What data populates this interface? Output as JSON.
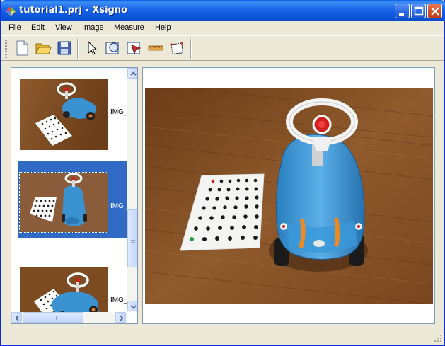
{
  "window": {
    "title": "tutorial1.prj - Xsigno",
    "title_bar_color": "#0a54dc"
  },
  "menu": {
    "items": [
      "File",
      "Edit",
      "View",
      "Image",
      "Measure",
      "Help"
    ]
  },
  "toolbar": {
    "icons": [
      "new-document-icon",
      "open-folder-icon",
      "save-disk-icon",
      "select-arrow-icon",
      "circle-marker-icon",
      "region-marker-icon",
      "ruler-icon",
      "polygon-icon"
    ]
  },
  "thumbnails": {
    "items": [
      {
        "label": "IMG_",
        "selected": false
      },
      {
        "label": "IMG_",
        "selected": true
      },
      {
        "label": "IMG_",
        "selected": false
      }
    ],
    "selection_color": "#316ac5"
  },
  "colors": {
    "floor": "#8a5424",
    "car_blue": "#3a93d0",
    "target_pattern": "#ffffff"
  }
}
